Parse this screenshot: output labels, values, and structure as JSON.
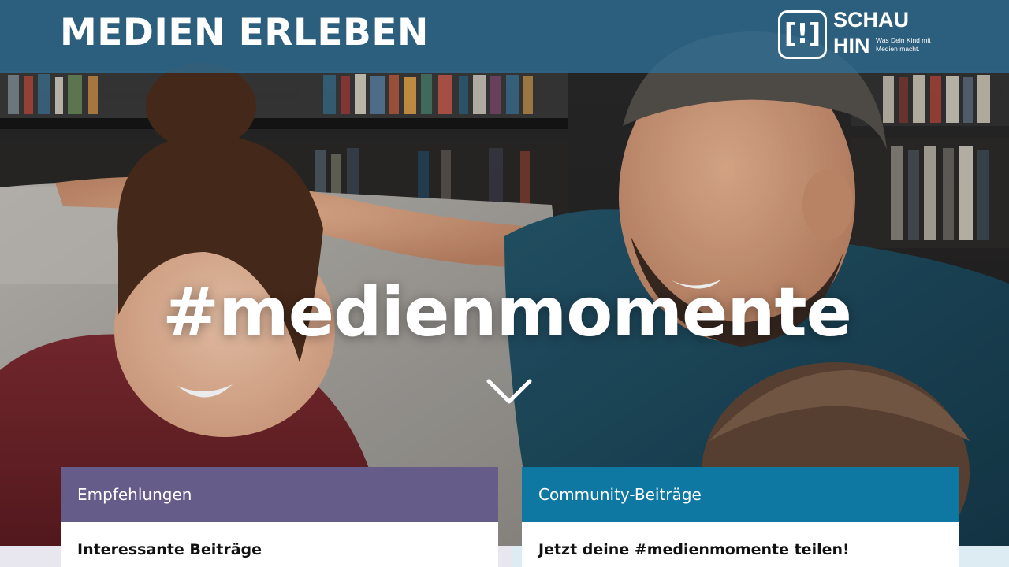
{
  "header": {
    "site_title": "MEDIEN ERLEBEN",
    "logo": {
      "mark": "[!]",
      "word_line1": "SCHAU",
      "word_line2": "HIN",
      "tagline": "Was Dein Kind mit Medien macht."
    },
    "background_color": "#2e6e96"
  },
  "hero": {
    "hashtag": "#medienmomente",
    "scroll_icon": "chevron-down-icon"
  },
  "cards": [
    {
      "title": "Empfehlungen",
      "subtitle": "Interessante Beiträge",
      "color": "#665c8a"
    },
    {
      "title": "Community-Beiträge",
      "subtitle": "Jetzt deine #medienmomente teilen!",
      "color": "#0f78a2"
    }
  ]
}
